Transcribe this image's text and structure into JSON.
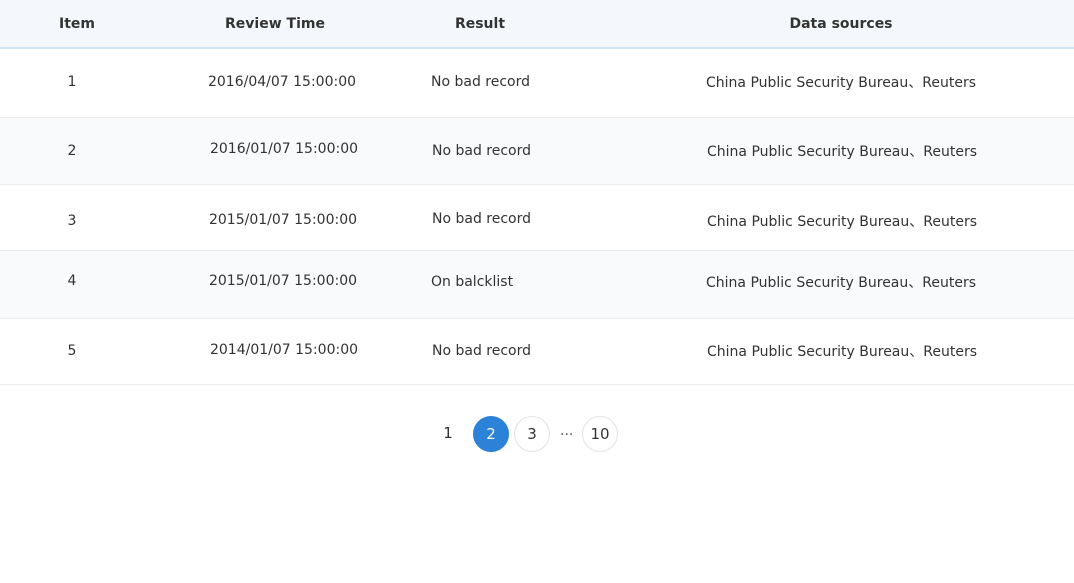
{
  "table": {
    "columns": [
      "Item",
      "Review Time",
      "Result",
      "Data sources"
    ],
    "rows": [
      {
        "item": "1",
        "time": "2016/04/07 15:00:00",
        "result": "No bad record",
        "source": "China Public Security Bureau、Reuters"
      },
      {
        "item": "2",
        "time": "2016/01/07 15:00:00",
        "result": "No bad record",
        "source": "China Public Security Bureau、Reuters"
      },
      {
        "item": "3",
        "time": "2015/01/07 15:00:00",
        "result": "No bad record",
        "source": "China Public Security Bureau、Reuters"
      },
      {
        "item": "4",
        "time": "2015/01/07 15:00:00",
        "result": "On balcklist",
        "source": "China Public Security Bureau、Reuters"
      },
      {
        "item": "5",
        "time": "2014/01/07 15:00:00",
        "result": "No bad record",
        "source": "China Public Security Bureau、Reuters"
      }
    ]
  },
  "pagination": {
    "pages": [
      "1",
      "2",
      "3",
      "10"
    ],
    "ellipsis": "...",
    "current": "2"
  },
  "colors": {
    "header_bg": "#f4f8fd",
    "header_border": "#cfe4f6",
    "alt_row_bg": "#f8fafc",
    "active_page": "#2b82d6"
  }
}
